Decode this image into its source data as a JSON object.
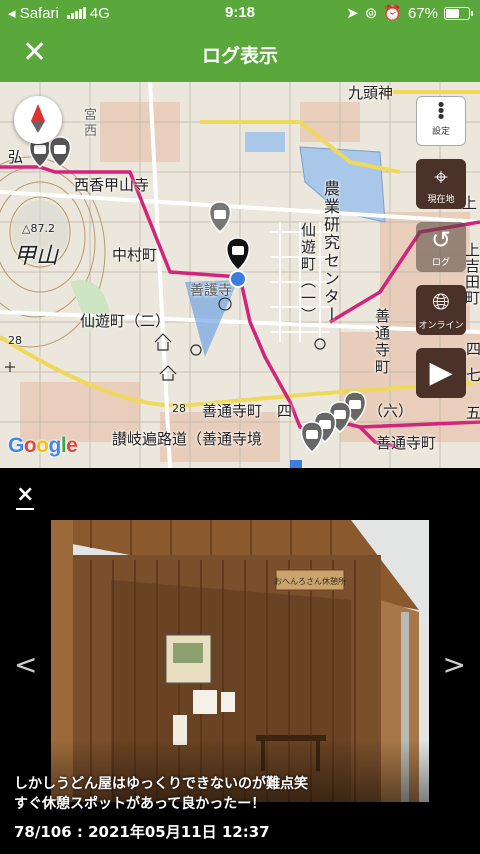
{
  "status": {
    "carrier": "◂ Safari",
    "network": "4G",
    "time": "9:18",
    "battery_text": "67%",
    "battery_level": 0.67
  },
  "nav": {
    "close_symbol": "✕",
    "title": "ログ表示"
  },
  "map": {
    "labels": {
      "kuzuremikami": "九頭神",
      "miya": "宮",
      "nishi": "西",
      "hiromi": "弘",
      "nishikoukou": "西香甲山寺",
      "nougyou": "農業研究センター",
      "kouyama": "甲山",
      "elevation": "△87.2",
      "nakamura": "中村町",
      "senyu_v": "仙遊町（一）",
      "zengoji": "善護寺",
      "senyu": "仙遊町（二）",
      "zentsuji_v": "善通寺町",
      "num28a": "28",
      "num28b": "28",
      "zentsujimachi4": "善通寺町　四",
      "roku": "（六）",
      "sanukihenro": "讃岐遍路道（善通寺境",
      "zentsujimachi": "善通寺町",
      "ue": "上",
      "kami": "上吉田町",
      "yon": "四",
      "nanatsu": "七",
      "go": "五"
    },
    "google_letters": [
      "G",
      "o",
      "o",
      "g",
      "l",
      "e"
    ],
    "google_colors": [
      "#4285F4",
      "#EA4335",
      "#FBBC05",
      "#4285F4",
      "#34A853",
      "#EA4335"
    ],
    "buttons": {
      "settings": "設定",
      "current_location": "現在地",
      "history": "ログ",
      "online": "オンライン"
    }
  },
  "viewer": {
    "close_symbol": "×",
    "prev_symbol": "<",
    "next_symbol": ">",
    "caption_line1": "しかしうどん屋はゆっくりできないのが難点笑",
    "caption_line2": "すぐ休憩スポットがあって良かったー！",
    "photo_index": "78/106",
    "photo_date": "2021年05月11日 12:37",
    "photo_sign": "おへんろさん休憩所"
  }
}
